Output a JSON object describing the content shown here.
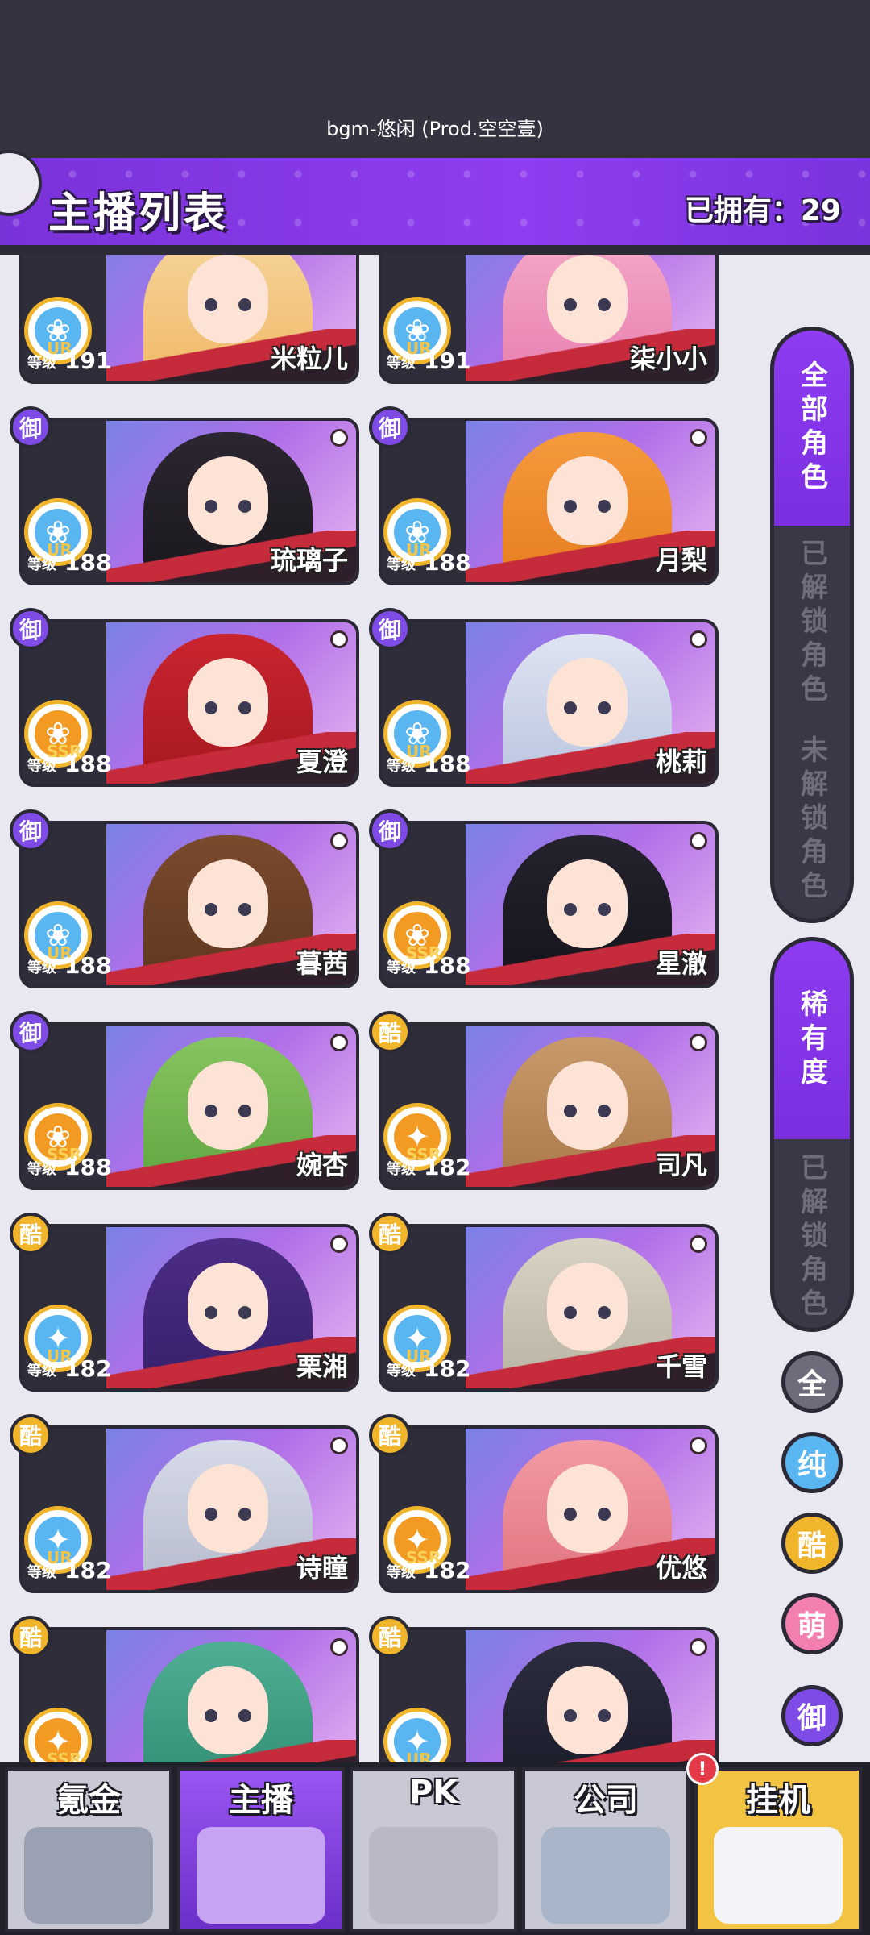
{
  "status": {
    "bgm": "bgm-悠闲 (Prod.空空壹)"
  },
  "header": {
    "title": "主播列表",
    "owned": "已拥有：29"
  },
  "colors": {
    "accent": "#8f3df0",
    "cool": "#f0b52b",
    "pure": "#5ab6f0",
    "cute": "#f27fb0",
    "royal": "#7e4be6"
  },
  "cards": [
    {
      "name": "米粒儿",
      "level": "191",
      "tag": "",
      "attr": "pure",
      "rank": "UR"
    },
    {
      "name": "柒小小",
      "level": "191",
      "tag": "",
      "attr": "pure",
      "rank": "UR"
    },
    {
      "name": "琉璃子",
      "level": "188",
      "tag": "御",
      "attr": "blue-rose",
      "rank": "UR"
    },
    {
      "name": "月梨",
      "level": "188",
      "tag": "御",
      "attr": "blue-rose",
      "rank": "UR"
    },
    {
      "name": "夏澄",
      "level": "188",
      "tag": "御",
      "attr": "orange-rose",
      "rank": "SSR"
    },
    {
      "name": "桃莉",
      "level": "188",
      "tag": "御",
      "attr": "blue-rose",
      "rank": "UR"
    },
    {
      "name": "暮茜",
      "level": "188",
      "tag": "御",
      "attr": "blue-rose",
      "rank": "UR"
    },
    {
      "name": "星澈",
      "level": "188",
      "tag": "御",
      "attr": "orange-rose",
      "rank": "SSR"
    },
    {
      "name": "婉杏",
      "level": "188",
      "tag": "御",
      "attr": "orange-rose",
      "rank": "SSR"
    },
    {
      "name": "司凡",
      "level": "182",
      "tag": "酷",
      "attr": "orange-star",
      "rank": "SSR"
    },
    {
      "name": "栗湘",
      "level": "182",
      "tag": "酷",
      "attr": "blue-star",
      "rank": "UR"
    },
    {
      "name": "千雪",
      "level": "182",
      "tag": "酷",
      "attr": "blue-star",
      "rank": "UR"
    },
    {
      "name": "诗瞳",
      "level": "182",
      "tag": "酷",
      "attr": "blue-star",
      "rank": "UR"
    },
    {
      "name": "优悠",
      "level": "182",
      "tag": "酷",
      "attr": "orange-star",
      "rank": "SSR"
    },
    {
      "name": "",
      "level": "",
      "tag": "酷",
      "attr": "orange-star",
      "rank": "SSR"
    },
    {
      "name": "",
      "level": "",
      "tag": "酷",
      "attr": "blue-star",
      "rank": "UR"
    }
  ],
  "card_level_label": "等级",
  "filter_tabs": {
    "all": "全部角色",
    "unlocked": "已解锁角色",
    "locked": "未解锁角色",
    "rarity": "稀有度",
    "rarity_unlocked": "已解锁角色"
  },
  "attribute_filters": [
    "全",
    "纯",
    "酷",
    "萌",
    "御"
  ],
  "nav": [
    {
      "label": "氪金",
      "active": false
    },
    {
      "label": "主播",
      "active": true
    },
    {
      "label": "PK",
      "active": false
    },
    {
      "label": "公司",
      "active": false
    },
    {
      "label": "挂机",
      "active": false
    }
  ],
  "nav_alert": "!"
}
